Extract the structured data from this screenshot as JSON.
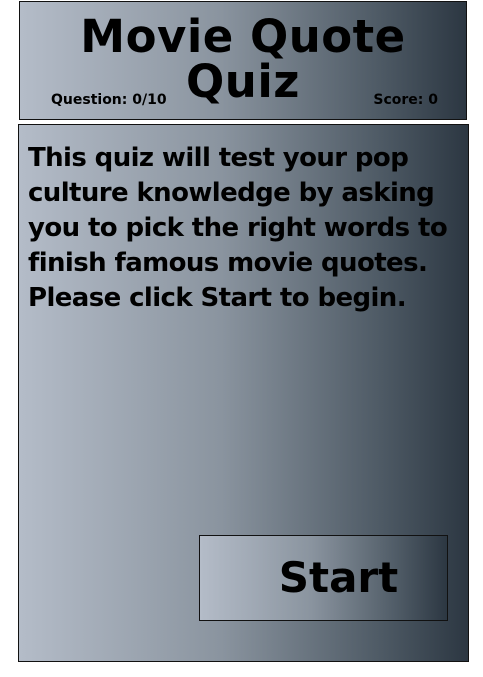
{
  "header": {
    "title": "Movie Quote Quiz",
    "question_status": "Question: 0/10",
    "score_status": "Score: 0"
  },
  "main": {
    "intro_text": "This quiz will test your pop culture knowledge by asking you to pick the right words to finish famous movie quotes. Please click Start to begin.",
    "start_label": "Start"
  },
  "colors": {
    "panel_gradient_light": "#b4bcc8",
    "panel_gradient_dark": "#2c3742",
    "text": "#000000",
    "border": "#111111"
  }
}
